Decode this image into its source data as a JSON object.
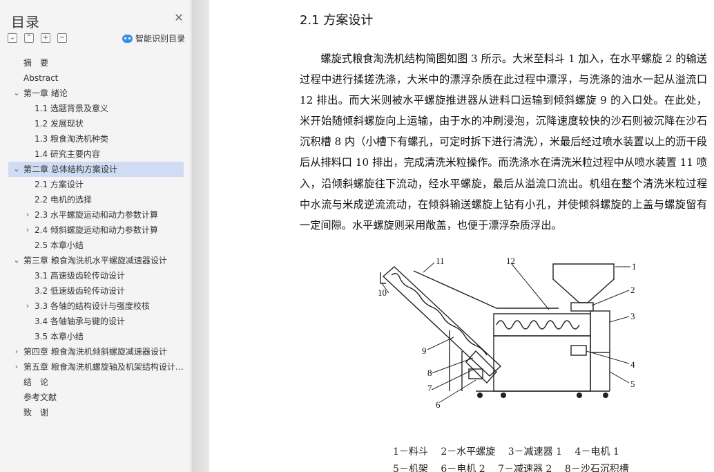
{
  "sidebar": {
    "title": "目录",
    "smart_toc_label": "智能识别目录",
    "items": [
      {
        "label": "摘　要",
        "level": 1,
        "chev": ""
      },
      {
        "label": "Abstract",
        "level": 1,
        "chev": ""
      },
      {
        "label": "第一章  绪论",
        "level": 1,
        "chev": "down"
      },
      {
        "label": "1.1 选题背景及意义",
        "level": 2,
        "chev": ""
      },
      {
        "label": "1.2 发展现状",
        "level": 2,
        "chev": ""
      },
      {
        "label": "1.3 粮食淘洗机种类",
        "level": 2,
        "chev": ""
      },
      {
        "label": "1.4 研究主要内容",
        "level": 2,
        "chev": ""
      },
      {
        "label": "第二章    总体结构方案设计",
        "level": 1,
        "chev": "down",
        "active": true
      },
      {
        "label": "2.1 方案设计",
        "level": 2,
        "chev": ""
      },
      {
        "label": "2.2 电机的选择",
        "level": 2,
        "chev": ""
      },
      {
        "label": "2.3 水平螺旋运动和动力参数计算",
        "level": 2,
        "chev": "right"
      },
      {
        "label": "2.4 倾斜螺旋运动和动力参数计算",
        "level": 2,
        "chev": "right"
      },
      {
        "label": "2.5 本章小结",
        "level": 2,
        "chev": ""
      },
      {
        "label": "第三章  粮食淘洗机水平螺旋减速器设计",
        "level": 1,
        "chev": "down"
      },
      {
        "label": "3.1 高速级齿轮传动设计",
        "level": 2,
        "chev": ""
      },
      {
        "label": "3.2 低速级齿轮传动设计",
        "level": 2,
        "chev": ""
      },
      {
        "label": "3.3  各轴的结构设计与强度校核",
        "level": 2,
        "chev": "right"
      },
      {
        "label": "3.4 各轴轴承与键的设计",
        "level": 2,
        "chev": ""
      },
      {
        "label": "3.5 本章小结",
        "level": 2,
        "chev": ""
      },
      {
        "label": "第四章  粮食淘洗机倾斜螺旋减速器设计",
        "level": 1,
        "chev": "right"
      },
      {
        "label": "第五章  粮食淘洗机螺旋轴及机架结构设计与强度校核",
        "level": 1,
        "chev": "right"
      },
      {
        "label": "结　论",
        "level": 1,
        "chev": ""
      },
      {
        "label": "参考文献",
        "level": 1,
        "chev": ""
      },
      {
        "label": "致　谢",
        "level": 1,
        "chev": ""
      }
    ]
  },
  "document": {
    "section_title": "2.1 方案设计",
    "paragraph": "螺旋式粮食淘洗机结构简图如图 3 所示。大米至料斗 1 加入，在水平螺旋 2 的输送过程中进行揉搓洗涤，大米中的漂浮杂质在此过程中漂浮，与洗涤的油水一起从溢流口 12 排出。而大米则被水平螺旋推进器从进料口运输到倾斜螺旋 9 的入口处。在此处，米开始随倾斜螺旋向上运输，由于水的冲刷浸泡，沉降速度较快的沙石则被沉降在沙石沉积槽 8 内（小槽下有螺孔，可定时拆下进行清洗），米最后经过喷水装置以上的沥干段后从排料口 10 排出，完成清洗米粒操作。而洗涤水在清洗米粒过程中从喷水装置 11 喷入，沿倾斜螺旋往下流动，经水平螺旋，最后从溢流口流出。机组在整个清洗米粒过程中水流与米成逆流流动，在倾斜输送螺旋上钻有小孔，并使倾斜螺旋的上盖与螺旋留有一定间隙。水平螺旋则采用敞盖，也便于漂浮杂质浮出。",
    "figure_numbers": [
      "1",
      "2",
      "3",
      "4",
      "5",
      "6",
      "7",
      "8",
      "9",
      "10",
      "11",
      "12"
    ],
    "caption_line1": [
      "1－料斗",
      "2－水平螺旋",
      "3－减速器 1",
      "4－电机 1"
    ],
    "caption_line2": [
      "5－机架",
      "6－电机 2",
      "7－减速器 2",
      "8－沙石沉积槽"
    ]
  }
}
